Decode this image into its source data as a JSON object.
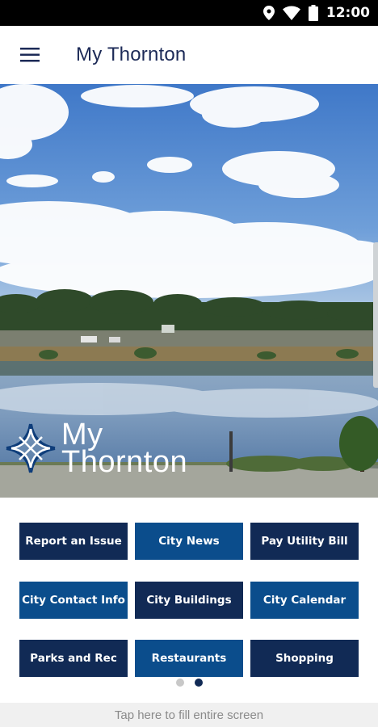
{
  "status_bar": {
    "time": "12:00",
    "icons": [
      "location-icon",
      "wifi-icon",
      "battery-icon"
    ]
  },
  "app_bar": {
    "menu_icon": "hamburger-menu-icon",
    "title": "My Thornton"
  },
  "hero": {
    "logo_line1": "My",
    "logo_line2": "Thornton"
  },
  "tiles": [
    {
      "label": "Report an Issue"
    },
    {
      "label": "City News"
    },
    {
      "label": "Pay Utility Bill"
    },
    {
      "label": "City Contact Info"
    },
    {
      "label": "City Buildings"
    },
    {
      "label": "City Calendar"
    },
    {
      "label": "Parks and Rec"
    },
    {
      "label": "Restaurants"
    },
    {
      "label": "Shopping"
    }
  ],
  "pager": {
    "pages": 2,
    "active_page": 2
  },
  "footer": {
    "text": "Tap here to fill entire screen"
  },
  "colors": {
    "tile_dark": "#112a55",
    "tile_mid": "#0b4d8c",
    "title": "#1c2a57"
  }
}
